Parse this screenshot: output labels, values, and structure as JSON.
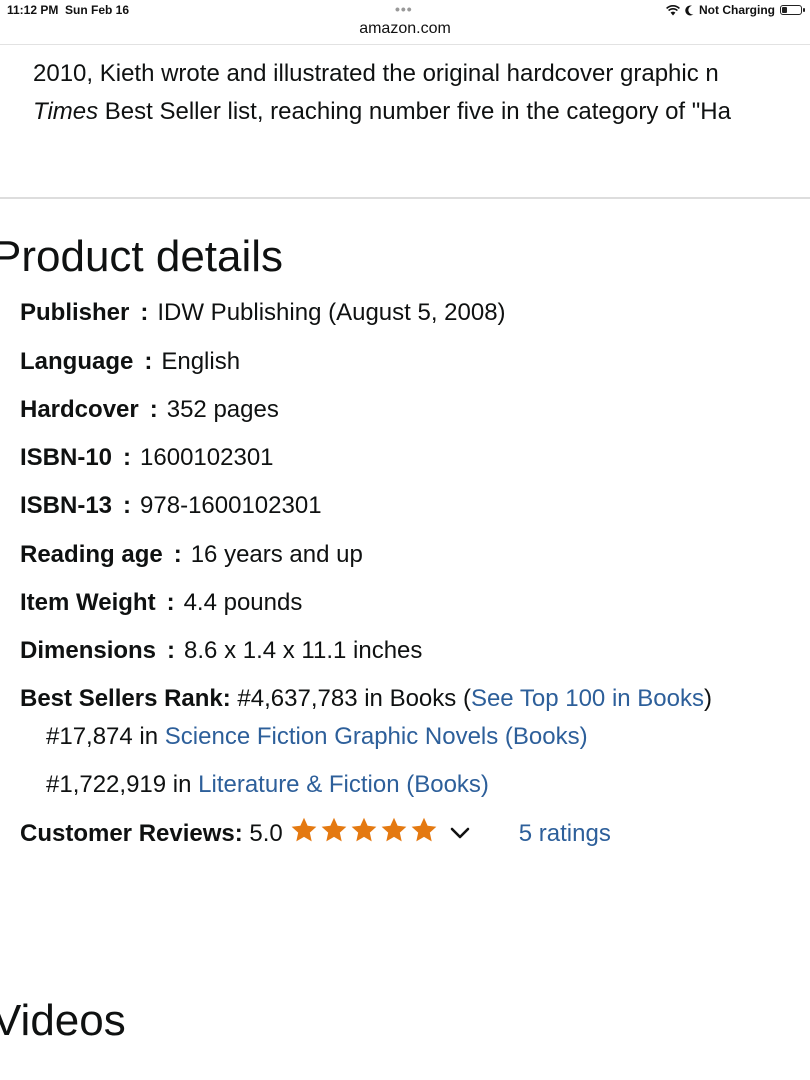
{
  "status_bar": {
    "time": "11:12 PM",
    "date": "Sun Feb 16",
    "dots": "•••",
    "charging": "Not Charging"
  },
  "browser": {
    "url": "amazon.com"
  },
  "intro": {
    "line1": "2010, Kieth wrote and illustrated the original hardcover graphic n",
    "line2_italic": "Times",
    "line2_rest": " Best Seller list, reaching number five in the category of \"Ha"
  },
  "product_details": {
    "title": "Product details",
    "rows": [
      {
        "label": "Publisher",
        "value": "IDW Publishing (August 5, 2008)"
      },
      {
        "label": "Language",
        "value": "English"
      },
      {
        "label": "Hardcover",
        "value": "352 pages"
      },
      {
        "label": "ISBN-10",
        "value": "1600102301"
      },
      {
        "label": "ISBN-13",
        "value": "978-1600102301"
      },
      {
        "label": "Reading age",
        "value": "16 years and up"
      },
      {
        "label": "Item Weight",
        "value": "4.4 pounds"
      },
      {
        "label": "Dimensions",
        "value": "8.6 x 1.4 x 11.1 inches"
      }
    ],
    "best_sellers": {
      "label": "Best Sellers Rank:",
      "rank": " #4,637,783 in Books (",
      "top100_link": "See Top 100 in Books",
      "close_paren": ")",
      "sub1_rank": "#17,874 in ",
      "sub1_link": "Science Fiction Graphic Novels (Books)",
      "sub2_rank": "#1,722,919 in ",
      "sub2_link": "Literature & Fiction (Books)"
    },
    "reviews": {
      "label": "Customer Reviews:",
      "score": " 5.0",
      "stars": 5,
      "ratings_link": "5 ratings"
    }
  },
  "videos": {
    "title": "Videos"
  },
  "colors": {
    "star": "#e47911",
    "link": "#2d5f9a",
    "text": "#0f1111"
  },
  "icons": [
    "wifi-icon",
    "moon-icon",
    "battery-icon",
    "star-icon",
    "chevron-down-icon"
  ]
}
